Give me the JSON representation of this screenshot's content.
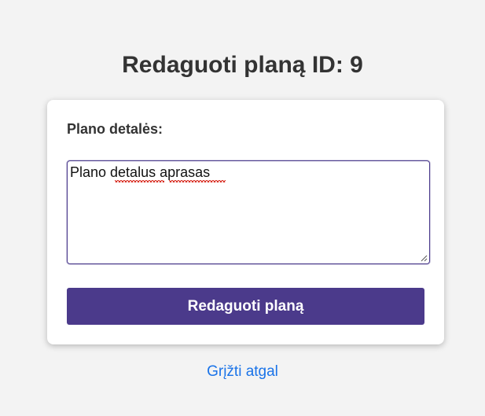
{
  "page": {
    "title": "Redaguoti planą ID: 9"
  },
  "form": {
    "details_label": "Plano detalės:",
    "details_value": "Plano detalus aprasas",
    "submit_label": "Redaguoti planą"
  },
  "navigation": {
    "back_label": "Grįžti atgal"
  },
  "colors": {
    "page_background": "#f3f3f3",
    "card_background": "#ffffff",
    "primary_button": "#4b3a8b",
    "link": "#1a73e8",
    "textarea_focus_border": "#4a3a8c",
    "spellcheck_underline": "#d93025"
  },
  "icons": {
    "textarea_resize": "resize-handle-icon"
  }
}
